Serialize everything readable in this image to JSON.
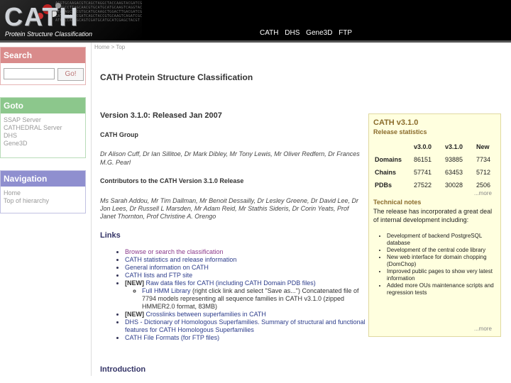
{
  "header": {
    "logo_text": "CATH",
    "logo_subtitle": "Protein Structure Classification",
    "nav": [
      "CATH",
      "DHS",
      "Gene3D",
      "FTP"
    ]
  },
  "sidebar": {
    "search": {
      "title": "Search",
      "placeholder": "",
      "button": "Go!"
    },
    "goto": {
      "title": "Goto",
      "items": [
        "SSAP Server",
        "CATHEDRAL Server",
        "DHS",
        "Gene3D"
      ]
    },
    "navigation": {
      "title": "Navigation",
      "items": [
        "Home",
        "Top of hierarchy"
      ]
    }
  },
  "breadcrumb": "Home > Top",
  "main": {
    "title": "CATH Protein Structure Classification",
    "version": "Version 3.1.0: Released Jan 2007",
    "group_heading": "CATH Group",
    "group_text": "Dr Alison Cuff, Dr Ian Sillitoe, Dr Mark Dibley, Mr Tony Lewis, Mr Oliver Redfern, Dr Frances M.G. Pearl",
    "contrib_heading": "Contributors to the CATH Version 3.1.0 Release",
    "contrib_text": "Ms Sarah Addou, Mr Tim Dallman, Mr Benoit Dessailly, Dr Lesley Greene, Dr David Lee, Dr Jon Lees, Dr Russell L Marsden, Mr Adam Reid, Mr Stathis Sideris, Dr Corin Yeats, Prof Janet Thornton, Prof Christine A. Orengo",
    "links_heading": "Links",
    "links": {
      "l1": "Browse or search the classification",
      "l2": "CATH statistics and release information",
      "l3": "General information on CATH",
      "l4": "CATH lists and FTP site",
      "new": "[NEW]",
      "l5": "Raw data files for CATH (including CATH Domain PDB files)",
      "sub_link": "Full HMM Library",
      "sub_rest": " (right click link and select \"Save as...\") Concatenated file of 7794 models representing all sequence families in CATH v3.1.0 (zipped HMMER2.0 format, 83MB)",
      "l6": "Crosslinks between superfamilies in CATH",
      "l7_link": "DHS - Dictionary of Homologous Superfamilies",
      "l7_rest": ". Summary of structural and functional features for CATH Homologous Superfamilies",
      "l8": "CATH File Formats (for FTP files)"
    },
    "intro_heading": "Introduction"
  },
  "release": {
    "title": "CATH v3.1.0",
    "subtitle": "Release statistics",
    "columns": [
      "",
      "v3.0.0",
      "v3.1.0",
      "New"
    ],
    "rows": [
      [
        "Domains",
        "86151",
        "93885",
        "7734"
      ],
      [
        "Chains",
        "57741",
        "63453",
        "5712"
      ],
      [
        "PDBs",
        "27522",
        "30028",
        "2506"
      ]
    ],
    "more": "...more",
    "tech_heading": "Technical notes",
    "tech_text": "The release has incorporated a great deal of internal development including:",
    "tech_items": [
      "Development of backend PostgreSQL database",
      "Development of the central code library",
      "New web interface for domain chopping (DomChop)",
      "Improved public pages to show very latest information",
      "Added more OUs maintenance scripts and regression tests"
    ],
    "more2": "...more"
  }
}
